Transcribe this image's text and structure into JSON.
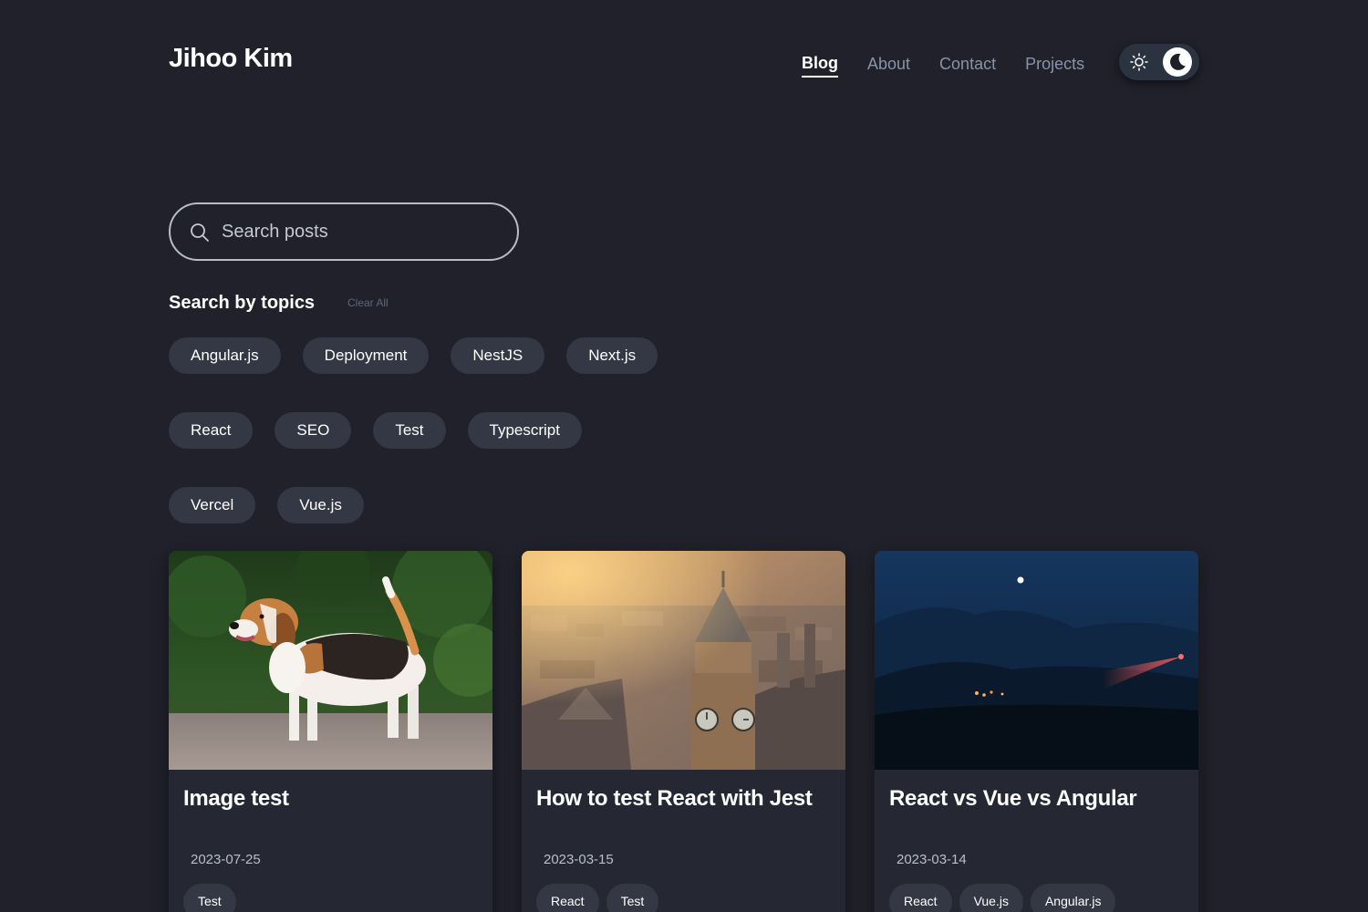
{
  "header": {
    "site_title": "Jihoo Kim",
    "nav": [
      {
        "label": "Blog",
        "active": true
      },
      {
        "label": "About",
        "active": false
      },
      {
        "label": "Contact",
        "active": false
      },
      {
        "label": "Projects",
        "active": false
      }
    ],
    "theme": "dark"
  },
  "search": {
    "placeholder": "Search posts",
    "value": ""
  },
  "topics": {
    "heading": "Search by topics",
    "clear_label": "Clear All",
    "items": [
      "Angular.js",
      "Deployment",
      "NestJS",
      "Next.js",
      "React",
      "SEO",
      "Test",
      "Typescript",
      "Vercel",
      "Vue.js"
    ]
  },
  "posts": [
    {
      "title": "Image test",
      "date": "2023-07-25",
      "tags": [
        "Test"
      ],
      "image": "beagle-dog-photo"
    },
    {
      "title": "How to test React with Jest",
      "date": "2023-03-15",
      "tags": [
        "React",
        "Test"
      ],
      "image": "big-ben-city-photo"
    },
    {
      "title": "React vs Vue vs Angular",
      "date": "2023-03-14",
      "tags": [
        "React",
        "Vue.js",
        "Angular.js"
      ],
      "image": "night-mountain-photo"
    }
  ],
  "colors": {
    "background": "#20212b",
    "chip": "#343845",
    "card": "#252833",
    "nav_inactive": "#8a93a6"
  }
}
